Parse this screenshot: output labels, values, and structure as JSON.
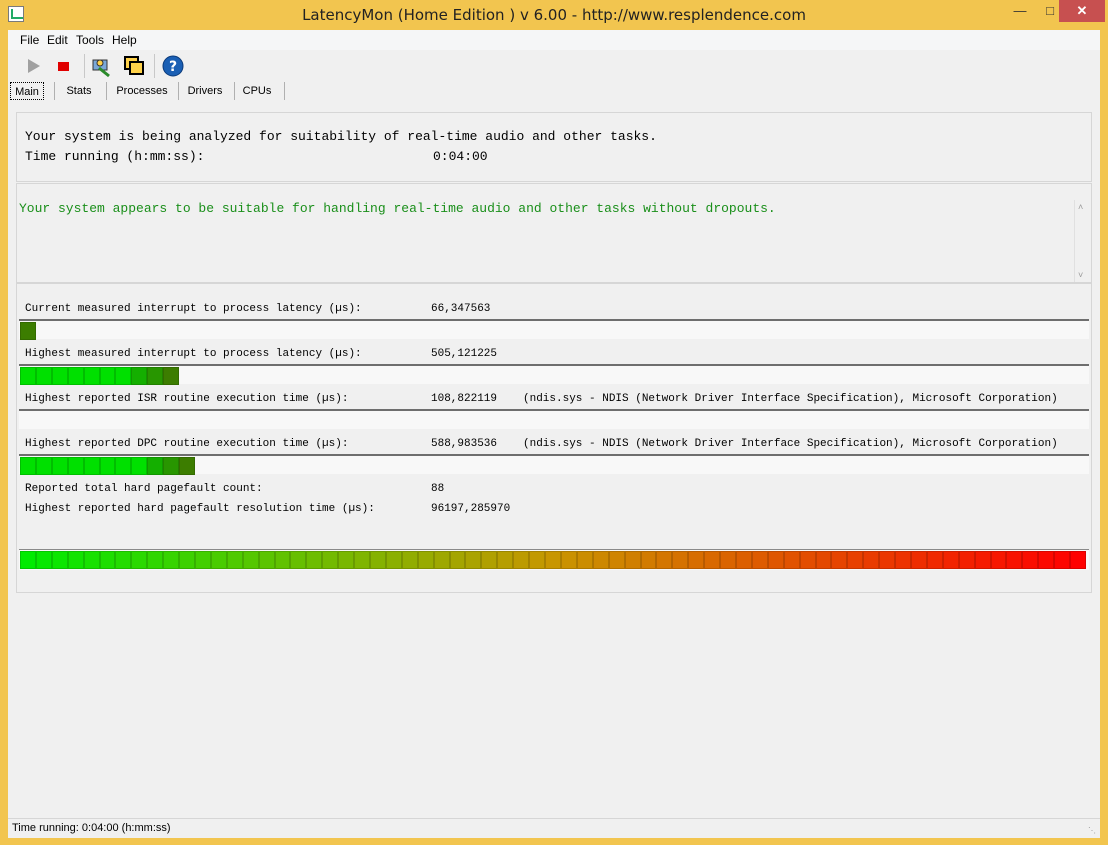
{
  "window": {
    "title": "LatencyMon  (Home Edition )  v 6.00 - http://www.resplendence.com"
  },
  "menu": {
    "file": "File",
    "edit": "Edit",
    "tools": "Tools",
    "help": "Help"
  },
  "toolbar": {
    "icons": [
      "play-icon",
      "stop-icon",
      "analyze-icon",
      "windows-icon",
      "help-icon"
    ],
    "stop_color": "#e00000",
    "help_color": "#1a5fb4"
  },
  "tabs": [
    "Main",
    "Stats",
    "Processes",
    "Drivers",
    "CPUs"
  ],
  "main": {
    "analyzing_text": "Your system is being analyzed for suitability of real-time audio and other tasks.",
    "time_running_label": "Time running (h:mm:ss):",
    "time_running_value": "0:04:00",
    "verdict": "Your system appears to be suitable for handling real-time audio and other tasks without dropouts.",
    "verdict_color": "#1a8f1a",
    "metrics": [
      {
        "label": "Current measured interrupt to process latency (µs):",
        "value": "66,347563",
        "bar_segments": 1,
        "bar_percent": 1.2
      },
      {
        "label": "Highest measured interrupt to process latency (µs):",
        "value": "505,121225",
        "bar_segments": 10,
        "bar_percent": 14.8
      },
      {
        "label": "Highest reported ISR routine execution time (µs):",
        "value": "108,822119",
        "detail": "(ndis.sys - NDIS (Network Driver Interface Specification), Microsoft Corporation)",
        "bar_segments": 0,
        "bar_percent": 0
      },
      {
        "label": "Highest reported DPC routine execution time (µs):",
        "value": "588,983536",
        "detail": "(ndis.sys - NDIS (Network Driver Interface Specification), Microsoft Corporation)",
        "bar_segments": 11,
        "bar_percent": 16.2
      },
      {
        "label": "Reported total hard pagefault count:",
        "value": "88"
      },
      {
        "label": "Highest reported hard pagefault resolution time (µs):",
        "value": "96197,285970",
        "bar_segments": 67,
        "bar_percent": 100
      }
    ]
  },
  "status": {
    "text": "Time running: 0:04:00  (h:mm:ss)"
  }
}
